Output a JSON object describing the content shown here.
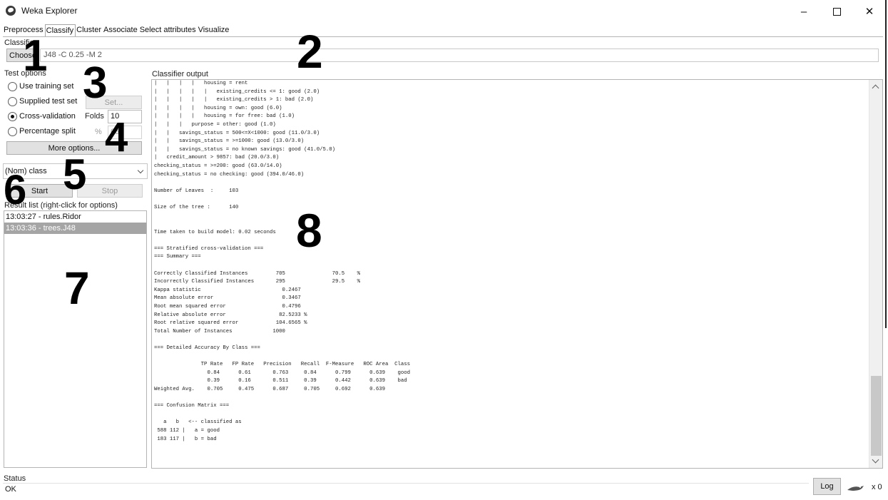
{
  "window": {
    "title": "Weka Explorer",
    "minimize": "–",
    "close": "✕"
  },
  "tabs": [
    "Preprocess",
    "Classify",
    "Cluster",
    "Associate",
    "Select attributes",
    "Visualize"
  ],
  "classifier": {
    "section_label": "Classifier",
    "choose_label": "Choose",
    "value": "J48 -C 0.25 -M 2"
  },
  "test_options": {
    "section_label": "Test options",
    "use_training": "Use training set",
    "supplied": "Supplied test set",
    "set_button": "Set...",
    "cross_validation": "Cross-validation",
    "folds_label": "Folds",
    "folds_value": "10",
    "percentage": "Percentage split",
    "percent_symbol": "%",
    "percent_value": "66",
    "more_options": "More options...",
    "selected": "cross_validation"
  },
  "class_select": {
    "value": "(Nom) class"
  },
  "actions": {
    "start": "Start",
    "stop": "Stop"
  },
  "result_list": {
    "label": "Result list (right-click for options)",
    "items": [
      "13:03:27 - rules.Ridor",
      "13:03:36 - trees.J48"
    ],
    "selected_index": 1
  },
  "output": {
    "label": "Classifier output",
    "text": "|   |   |   |   housing = rent\n|   |   |   |   |   existing_credits <= 1: good (2.0)\n|   |   |   |   |   existing_credits > 1: bad (2.0)\n|   |   |   |   housing = own: good (6.0)\n|   |   |   |   housing = for free: bad (1.0)\n|   |   |   purpose = other: good (1.0)\n|   |   savings_status = 500<=X<1000: good (11.0/3.0)\n|   |   savings_status = >=1000: good (13.0/3.0)\n|   |   savings_status = no known savings: good (41.0/5.0)\n|   credit_amount > 9857: bad (20.0/3.0)\nchecking_status = >=200: good (63.0/14.0)\nchecking_status = no checking: good (394.0/46.0)\n\nNumber of Leaves  :     103\n\nSize of the tree :      140\n\n\nTime taken to build model: 0.02 seconds\n\n=== Stratified cross-validation ===\n=== Summary ===\n\nCorrectly Classified Instances         705               70.5    %\nIncorrectly Classified Instances       295               29.5    %\nKappa statistic                          0.2467\nMean absolute error                      0.3467\nRoot mean squared error                  0.4796\nRelative absolute error                 82.5233 %\nRoot relative squared error            104.6565 %\nTotal Number of Instances             1000\n\n=== Detailed Accuracy By Class ===\n\n               TP Rate   FP Rate   Precision   Recall  F-Measure   ROC Area  Class\n                 0.84      0.61       0.763     0.84      0.799      0.639    good\n                 0.39      0.16       0.511     0.39      0.442      0.639    bad\nWeighted Avg.    0.705     0.475      0.687     0.705     0.692      0.639\n\n=== Confusion Matrix ===\n\n   a   b   <-- classified as\n 588 112 |   a = good\n 183 117 |   b = bad"
  },
  "status": {
    "label": "Status",
    "text": "OK",
    "log_label": "Log",
    "count": "x 0"
  },
  "annotations": [
    "1",
    "2",
    "3",
    "4",
    "5",
    "6",
    "7",
    "8"
  ]
}
